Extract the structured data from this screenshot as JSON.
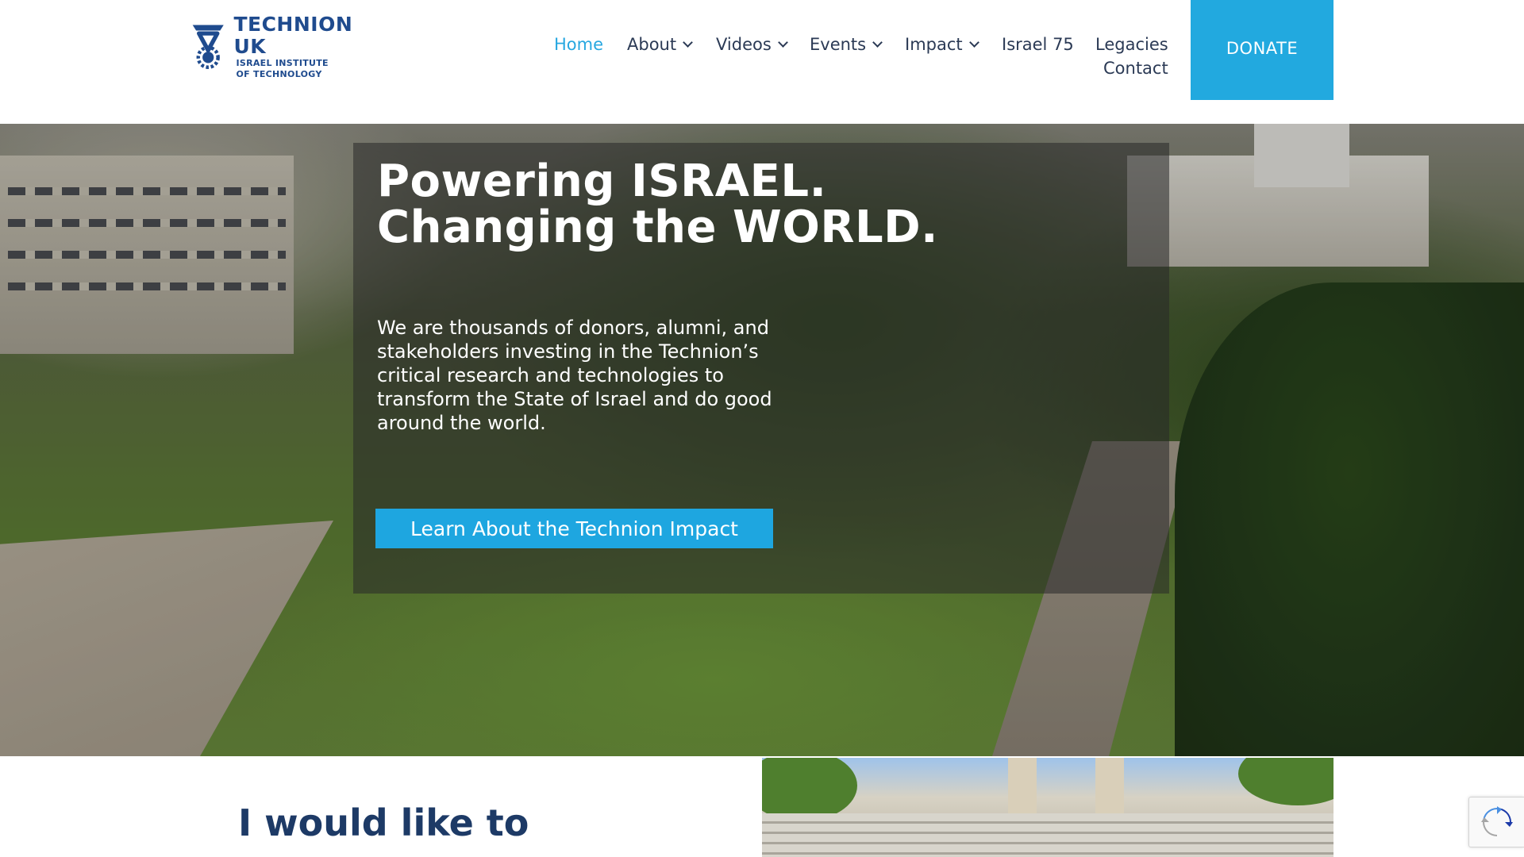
{
  "header": {
    "logo": {
      "title": "TECHNION UK",
      "subtitle_line1": "ISRAEL INSTITUTE",
      "subtitle_line2": "OF TECHNOLOGY"
    },
    "nav": [
      {
        "label": "Home",
        "active": true,
        "has_dropdown": false
      },
      {
        "label": "About",
        "active": false,
        "has_dropdown": true
      },
      {
        "label": "Videos",
        "active": false,
        "has_dropdown": true
      },
      {
        "label": "Events",
        "active": false,
        "has_dropdown": true
      },
      {
        "label": "Impact",
        "active": false,
        "has_dropdown": true
      },
      {
        "label": "Israel 75",
        "active": false,
        "has_dropdown": false
      },
      {
        "label": "Legacies",
        "active": false,
        "has_dropdown": false
      },
      {
        "label": "Contact",
        "active": false,
        "has_dropdown": false
      }
    ],
    "donate_label": "DONATE"
  },
  "hero": {
    "title_line1_pre": "Powering ",
    "title_line1_bold": "ISRAEL",
    "title_line1_end": ".",
    "title_line2_pre": "Changing the ",
    "title_line2_bold": "WORLD",
    "title_line2_end": ".",
    "text": "We are thousands of donors, alumni, and stakeholders investing in the Technion’s critical research and technologies to transform the State of Israel and do good around the world.",
    "cta_label": "Learn About the Technion Impact"
  },
  "lower": {
    "heading": "I would like to"
  },
  "colors": {
    "accent": "#22a9df",
    "brand": "#1f4b8e",
    "nav_text": "#2b3a55",
    "heading": "#1d3a66"
  },
  "icons": {
    "logo": "technion-logo-icon",
    "dropdown": "chevron-down-icon",
    "recaptcha": "recaptcha-icon"
  }
}
